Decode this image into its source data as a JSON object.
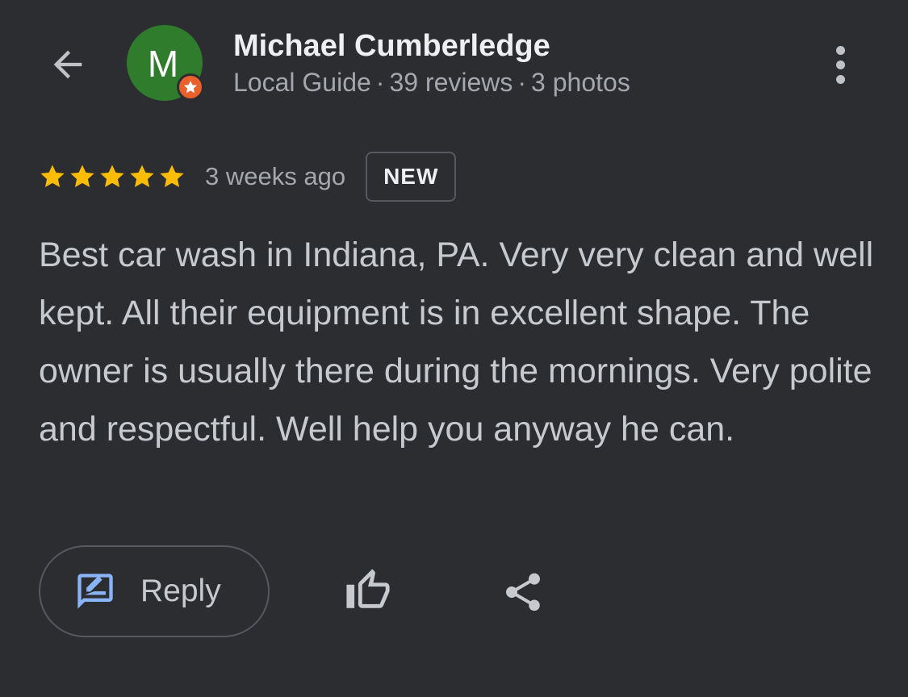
{
  "header": {
    "back_icon": "arrow-back-icon",
    "avatar_letter": "M",
    "avatar_color": "#2f7d2c",
    "badge_color": "#e8612c",
    "badge_icon": "star-icon",
    "name": "Michael Cumberledge",
    "meta": {
      "role": "Local Guide",
      "separator": "·",
      "reviews": "39 reviews",
      "photos": "3 photos"
    },
    "more_icon": "more-vert-icon"
  },
  "review": {
    "rating": 5,
    "max_rating": 5,
    "star_color": "#fbbc04",
    "time_ago": "3 weeks ago",
    "badge": "NEW",
    "text": "Best car wash in Indiana, PA. Very very clean and well kept. All their equipment is in excellent shape. The owner is usually there during the mornings. Very polite and respectful. Well help you anyway he can."
  },
  "actions": {
    "reply_label": "Reply",
    "reply_icon": "rate-review-icon",
    "reply_icon_color": "#8ab4f8",
    "like_icon": "thumb-up-icon",
    "share_icon": "share-icon"
  }
}
